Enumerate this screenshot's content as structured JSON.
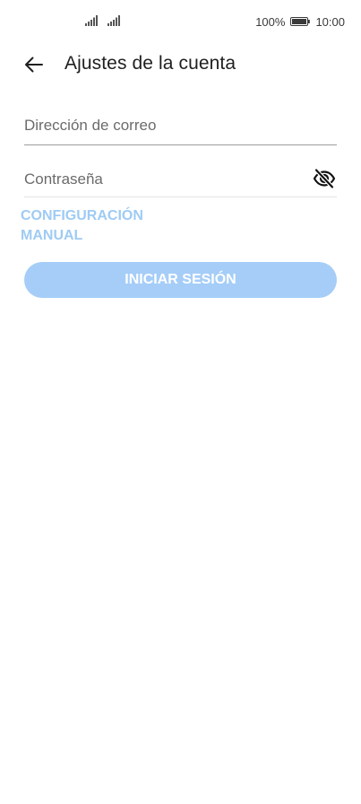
{
  "status_bar": {
    "battery_percent": "100%",
    "time": "10:00",
    "icons": [
      "signal-icon",
      "signal-icon",
      "battery-icon"
    ]
  },
  "header": {
    "title": "Ajustes de la cuenta",
    "back_icon": "back-arrow-icon"
  },
  "form": {
    "email_placeholder": "Dirección de correo",
    "email_value": "",
    "password_placeholder": "Contraseña",
    "password_value": "",
    "password_toggle_icon": "eye-off-icon"
  },
  "manual_config": {
    "line1": "CONFIGURACIÓN",
    "line2": "MANUAL"
  },
  "signin_button": {
    "label": "INICIAR SESIÓN"
  },
  "colors": {
    "accent_disabled": "#a5cdf8",
    "link_disabled": "#9fcbf4",
    "text_primary": "#1f1f1f",
    "placeholder": "#6b6b6b"
  }
}
